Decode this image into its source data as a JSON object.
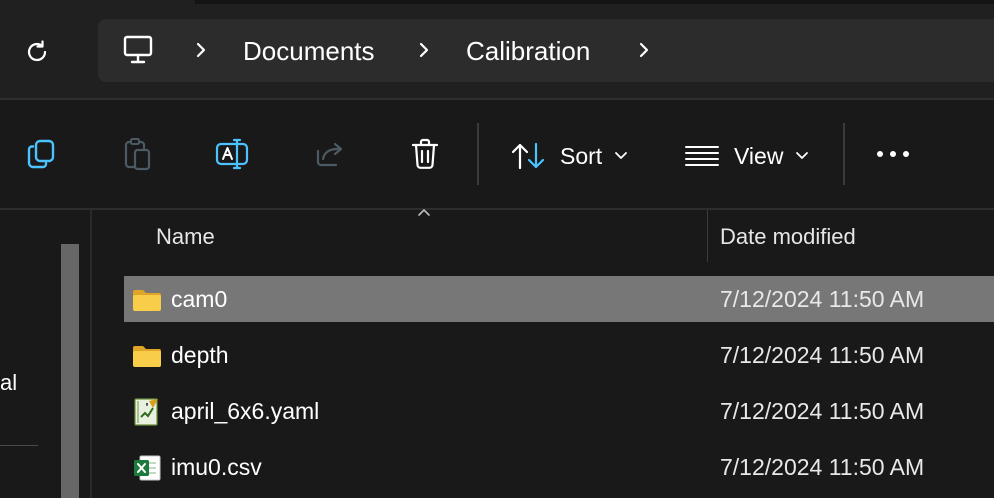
{
  "breadcrumb": {
    "root_icon": "computer-icon",
    "items": [
      "Documents",
      "Calibration"
    ]
  },
  "toolbar": {
    "copy_icon": "copy-icon",
    "paste_icon": "paste-icon",
    "rename_icon": "rename-icon",
    "share_icon": "share-icon",
    "delete_icon": "trash-icon",
    "sort_label": "Sort",
    "view_label": "View",
    "more_icon": "more-icon"
  },
  "nav": {
    "partial_text": "al"
  },
  "columns": {
    "name": "Name",
    "date": "Date modified"
  },
  "files": [
    {
      "name": "cam0",
      "date": "7/12/2024 11:50 AM",
      "type": "folder",
      "selected": true
    },
    {
      "name": "depth",
      "date": "7/12/2024 11:50 AM",
      "type": "folder",
      "selected": false
    },
    {
      "name": "april_6x6.yaml",
      "date": "7/12/2024 11:50 AM",
      "type": "text-editor-file",
      "selected": false
    },
    {
      "name": "imu0.csv",
      "date": "7/12/2024 11:50 AM",
      "type": "excel-file",
      "selected": false
    }
  ],
  "colors": {
    "background": "#191919",
    "address_bar": "#2c2c2c",
    "selection": "#777777",
    "accent": "#4cc2ff",
    "folder": "#f5c440"
  }
}
